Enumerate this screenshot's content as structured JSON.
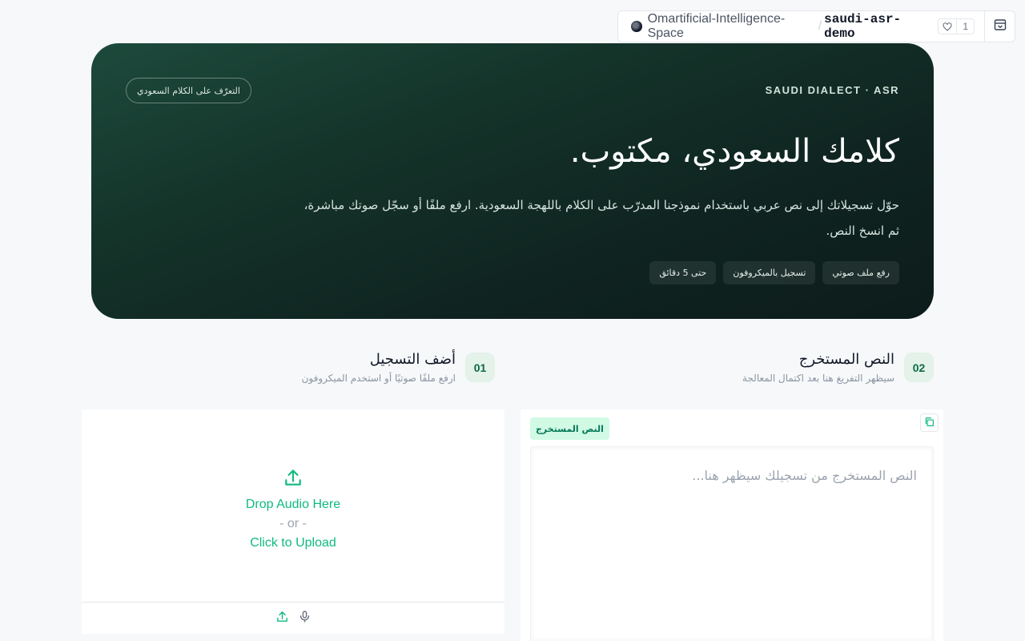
{
  "space": {
    "owner": "Omartificial-Intelligence-Space",
    "separator": "/",
    "repo": "saudi-asr-demo",
    "likes": "1"
  },
  "hero": {
    "eyebrow": "SAUDI DIALECT · ASR",
    "pill": "التعرّف على الكلام السعودي",
    "title": "كلامك السعودي، مكتوب.",
    "description": "حوّل تسجيلاتك إلى نص عربي باستخدام نموذجنا المدرّب على الكلام باللهجة السعودية. ارفع ملفًا أو سجّل صوتك مباشرة، ثم انسخ النص.",
    "chips": [
      "رفع ملف صوتي",
      "تسجيل بالميكروفون",
      "حتى 5 دقائق"
    ]
  },
  "sections": {
    "input": {
      "number": "01",
      "title": "أضف التسجيل",
      "subtitle": "ارفع ملفًا صوتيًا أو استخدم الميكروفون"
    },
    "output": {
      "number": "02",
      "title": "النص المستخرج",
      "subtitle": "سيظهر التفريغ هنا بعد اكتمال المعالجة"
    }
  },
  "upload": {
    "drop_text": "Drop Audio Here",
    "or_text": "- or -",
    "click_text": "Click to Upload"
  },
  "transcript": {
    "label": "النص المستخرج",
    "placeholder": "النص المستخرج من تسجيلك سيظهر هنا..."
  },
  "colors": {
    "accent": "#10b981",
    "hero_bg": "#143329",
    "badge_bg": "#e4f2ea",
    "badge_text": "#0b6b45"
  }
}
